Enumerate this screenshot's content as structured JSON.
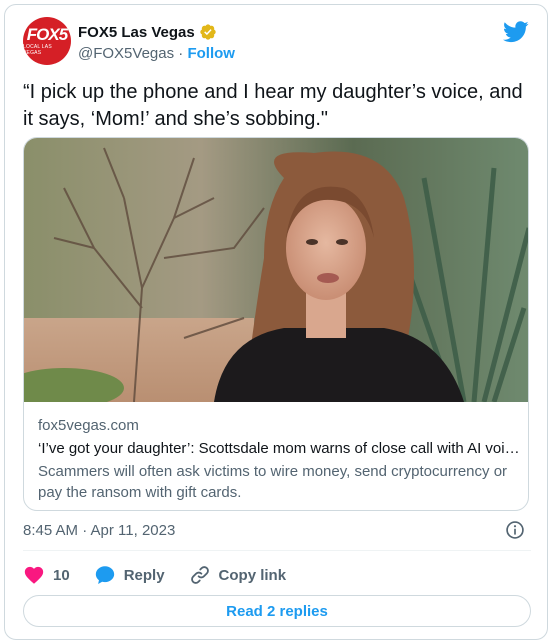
{
  "author": {
    "name": "FOX5 Las Vegas",
    "handle": "@FOX5Vegas",
    "separator": "·",
    "follow_label": "Follow",
    "avatar": {
      "logo_text": "FOX5",
      "logo_subtext": "LOCAL LAS VEGAS",
      "brand_color": "#d51f26"
    }
  },
  "tweet": {
    "text": "“I pick up the phone and I hear my daughter’s voice, and it says, ‘Mom!’ and she’s sobbing.\""
  },
  "link_card": {
    "domain": "fox5vegas.com",
    "title": "‘I’ve got your daughter’: Scottsdale mom warns of close call with AI voi…",
    "description": "Scammers will often ask victims to wire money, send cryptocurrency or pay the ransom with gift cards."
  },
  "meta": {
    "timestamp": "8:45 AM · Apr 11, 2023"
  },
  "actions": {
    "like_count": "10",
    "reply_label": "Reply",
    "copy_link_label": "Copy link"
  },
  "read_replies_label": "Read 2 replies",
  "colors": {
    "accent": "#1d9bf0",
    "like": "#f91880",
    "verified": "#e2b719",
    "text_primary": "#0f1419",
    "text_secondary": "#536471"
  },
  "icons": [
    "twitter-bird-icon",
    "verified-badge-icon",
    "info-icon",
    "heart-icon",
    "reply-bubble-icon",
    "link-icon"
  ]
}
